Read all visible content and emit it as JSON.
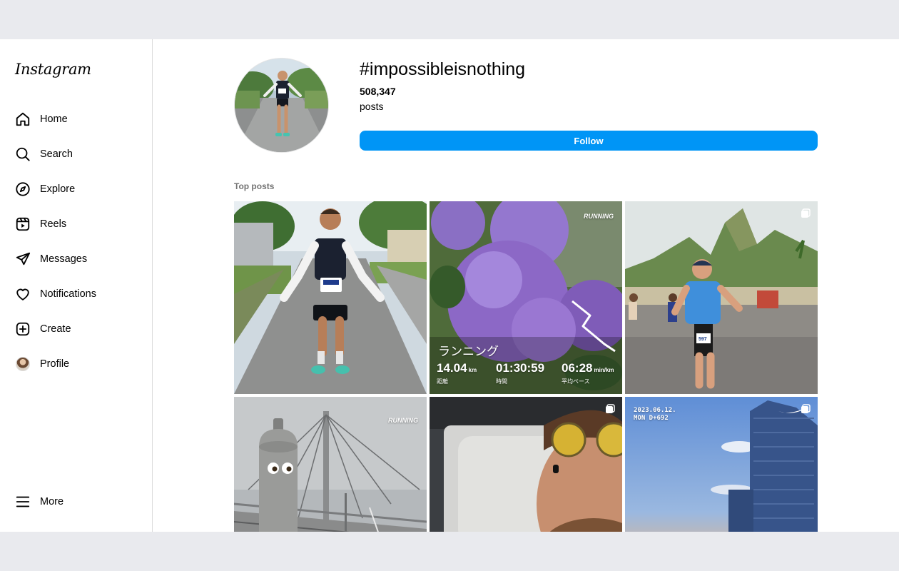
{
  "app": {
    "logo": "Instagram"
  },
  "sidebar": {
    "items": [
      {
        "label": "Home",
        "icon": "home-icon"
      },
      {
        "label": "Search",
        "icon": "search-icon"
      },
      {
        "label": "Explore",
        "icon": "compass-icon"
      },
      {
        "label": "Reels",
        "icon": "reels-icon"
      },
      {
        "label": "Messages",
        "icon": "paper-plane-icon"
      },
      {
        "label": "Notifications",
        "icon": "heart-icon"
      },
      {
        "label": "Create",
        "icon": "plus-square-icon"
      },
      {
        "label": "Profile",
        "icon": "avatar"
      }
    ],
    "more_label": "More"
  },
  "hashtag": {
    "title": "#impossibleisnothing",
    "post_count": "508,347",
    "post_label": "posts",
    "follow_label": "Follow"
  },
  "top_posts": {
    "title": "Top posts",
    "posts": [
      {
        "description": "runner-with-medal",
        "multi": false
      },
      {
        "description": "hydrangea-running-stats",
        "multi": false,
        "overlay": {
          "brand": "RUNNING",
          "activity": "ランニング",
          "distance": "14.04",
          "distance_unit": "km",
          "distance_label": "距離",
          "time": "01:30:59",
          "time_label": "時間",
          "pace": "06:28",
          "pace_unit": "min/km",
          "pace_label": "平均ペース"
        }
      },
      {
        "description": "runner-beach-mountains",
        "multi": true,
        "bib": "597"
      },
      {
        "description": "bottle-bridge",
        "multi": false,
        "overlay": {
          "brand": "RUNNING"
        }
      },
      {
        "description": "selfie-sunglasses",
        "multi": true
      },
      {
        "description": "tower-sunset",
        "multi": true,
        "overlay": {
          "date": "2023.06.12.",
          "day": "MON D+692"
        }
      }
    ]
  },
  "colors": {
    "accent": "#0095f6",
    "border": "#dbdbdb",
    "secondary_text": "#737373",
    "page_bg": "#e9eaee"
  }
}
